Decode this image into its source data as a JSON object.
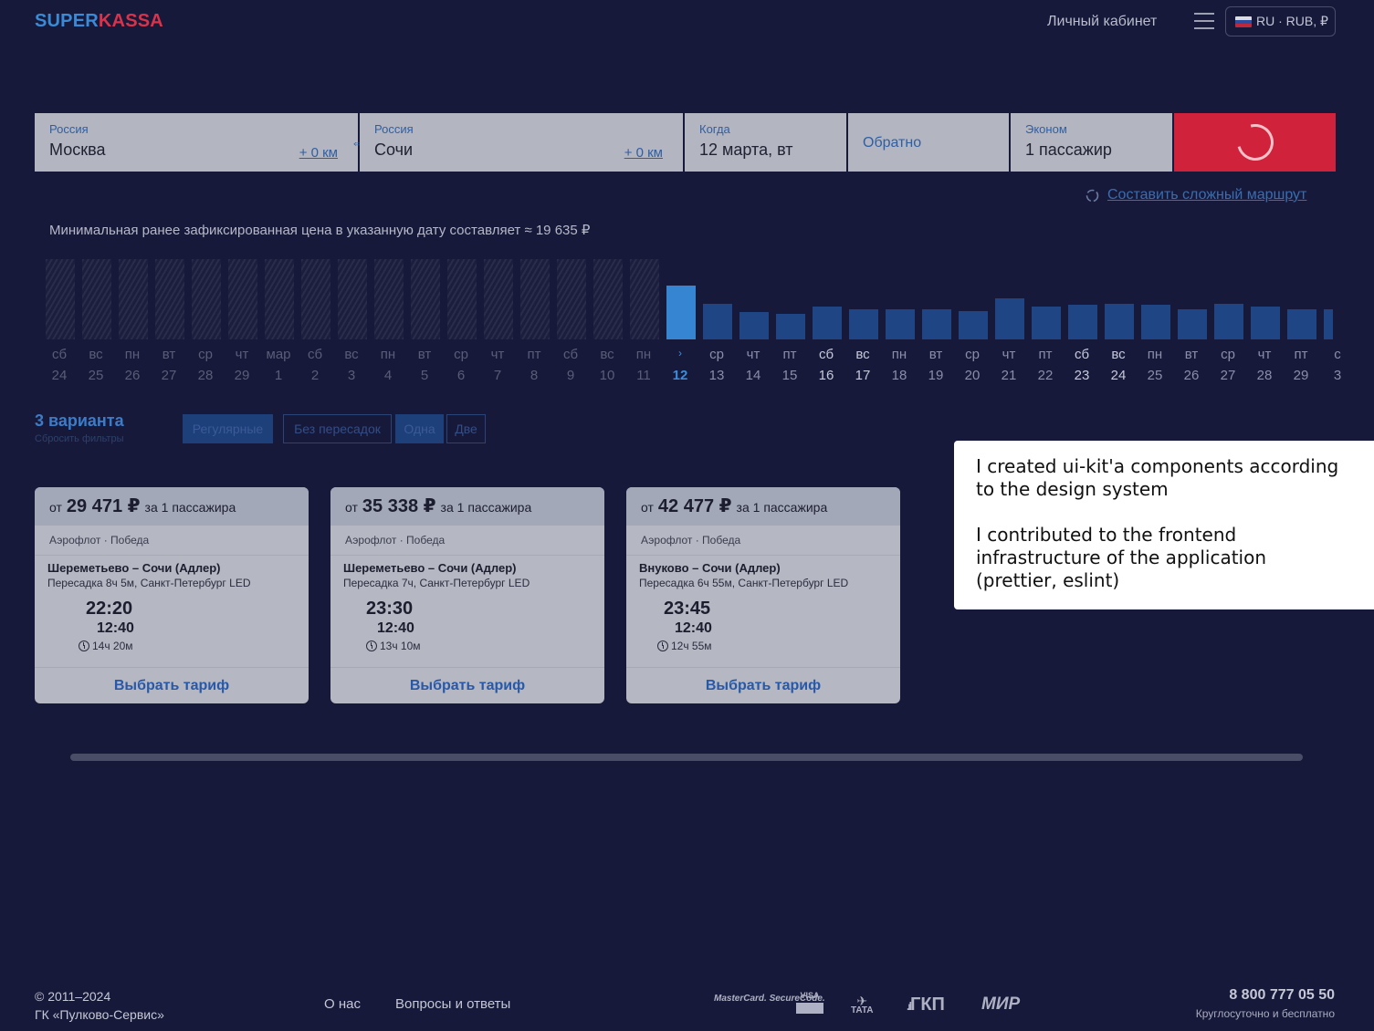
{
  "header": {
    "logo_part1": "SUPER",
    "logo_part2": "KASSA",
    "cabinet": "Личный кабинет",
    "lang": "RU · RUB, ₽"
  },
  "search": {
    "from_country": "Россия",
    "from_city": "Москва",
    "from_km": "+ 0 км",
    "to_country": "Россия",
    "to_city": "Сочи",
    "to_km": "+ 0 км",
    "when_label": "Когда",
    "when_value": "12 марта, вт",
    "return_label": "Обратно",
    "class_label": "Эконом",
    "passengers": "1 пассажир",
    "complex_route": "Составить сложный маршрут"
  },
  "min_price_text": "Минимальная ранее зафиксированная цена в указанную дату составляет ≈ 19 635 ₽",
  "calendar": {
    "selected_weekday_icon": "›",
    "days": [
      {
        "wd": "сб",
        "d": "24",
        "state": "past",
        "level": null
      },
      {
        "wd": "вс",
        "d": "25",
        "state": "past",
        "level": null
      },
      {
        "wd": "пн",
        "d": "26",
        "state": "past",
        "level": null
      },
      {
        "wd": "вт",
        "d": "27",
        "state": "past",
        "level": null
      },
      {
        "wd": "ср",
        "d": "28",
        "state": "past",
        "level": null
      },
      {
        "wd": "чт",
        "d": "29",
        "state": "past",
        "level": null
      },
      {
        "wd": "мар",
        "d": "1",
        "state": "past",
        "level": null
      },
      {
        "wd": "сб",
        "d": "2",
        "state": "past",
        "level": null
      },
      {
        "wd": "вс",
        "d": "3",
        "state": "past",
        "level": null
      },
      {
        "wd": "пн",
        "d": "4",
        "state": "past",
        "level": null
      },
      {
        "wd": "вт",
        "d": "5",
        "state": "past",
        "level": null
      },
      {
        "wd": "ср",
        "d": "6",
        "state": "past",
        "level": null
      },
      {
        "wd": "чт",
        "d": "7",
        "state": "past",
        "level": null
      },
      {
        "wd": "пт",
        "d": "8",
        "state": "past",
        "level": null
      },
      {
        "wd": "сб",
        "d": "9",
        "state": "past",
        "level": null
      },
      {
        "wd": "вс",
        "d": "10",
        "state": "past",
        "level": null
      },
      {
        "wd": "пн",
        "d": "11",
        "state": "past",
        "level": null
      },
      {
        "wd": "",
        "d": "12",
        "state": "selected",
        "level": 0.66
      },
      {
        "wd": "ср",
        "d": "13",
        "state": "future",
        "level": 0.43
      },
      {
        "wd": "чт",
        "d": "14",
        "state": "future",
        "level": 0.33
      },
      {
        "wd": "пт",
        "d": "15",
        "state": "future",
        "level": 0.31
      },
      {
        "wd": "сб",
        "d": "16",
        "state": "future",
        "level": 0.4
      },
      {
        "wd": "вс",
        "d": "17",
        "state": "future",
        "level": 0.37
      },
      {
        "wd": "пн",
        "d": "18",
        "state": "future",
        "level": 0.37
      },
      {
        "wd": "вт",
        "d": "19",
        "state": "future",
        "level": 0.37
      },
      {
        "wd": "ср",
        "d": "20",
        "state": "future",
        "level": 0.34
      },
      {
        "wd": "чт",
        "d": "21",
        "state": "future",
        "level": 0.5
      },
      {
        "wd": "пт",
        "d": "22",
        "state": "future",
        "level": 0.4
      },
      {
        "wd": "сб",
        "d": "23",
        "state": "future",
        "level": 0.42
      },
      {
        "wd": "вс",
        "d": "24",
        "state": "future",
        "level": 0.43
      },
      {
        "wd": "пн",
        "d": "25",
        "state": "future",
        "level": 0.42
      },
      {
        "wd": "вт",
        "d": "26",
        "state": "future",
        "level": 0.37
      },
      {
        "wd": "ср",
        "d": "27",
        "state": "future",
        "level": 0.43
      },
      {
        "wd": "чт",
        "d": "28",
        "state": "future",
        "level": 0.4
      },
      {
        "wd": "пт",
        "d": "29",
        "state": "future",
        "level": 0.37
      },
      {
        "wd": "с",
        "d": "3",
        "state": "future",
        "level": 0.37
      }
    ]
  },
  "filters": {
    "variants": "3 варианта",
    "reset": "Сбросить фильтры",
    "chips": [
      {
        "label": "Регулярные",
        "active": true
      },
      {
        "label": "Без пересадок",
        "active": false
      },
      {
        "label": "Одна",
        "active": true
      },
      {
        "label": "Две",
        "active": false
      }
    ]
  },
  "tooltip": {
    "p1": "I created ui-kit'a components according to the design system",
    "p2": "I contributed to the frontend infrastructure of the application (prettier, eslint)"
  },
  "cards": [
    {
      "from": "от",
      "price": "29 471 ₽",
      "per": "за 1 пассажира",
      "airlines": "Аэрофлот · Победа",
      "route": "Шереметьево – Сочи (Адлер)",
      "transfer": "Пересадка 8ч 5м, Санкт-Петербург LED",
      "dep": "22:20",
      "arr": "12:40",
      "dur": "14ч 20м",
      "cta": "Выбрать тариф"
    },
    {
      "from": "от",
      "price": "35 338 ₽",
      "per": "за 1 пассажира",
      "airlines": "Аэрофлот · Победа",
      "route": "Шереметьево – Сочи (Адлер)",
      "transfer": "Пересадка 7ч, Санкт-Петербург LED",
      "dep": "23:30",
      "arr": "12:40",
      "dur": "13ч 10м",
      "cta": "Выбрать тариф"
    },
    {
      "from": "от",
      "price": "42 477 ₽",
      "per": "за 1 пассажира",
      "airlines": "Аэрофлот · Победа",
      "route": "Внуково – Сочи (Адлер)",
      "transfer": "Пересадка 6ч 55м, Санкт-Петербург LED",
      "dep": "23:45",
      "arr": "12:40",
      "dur": "12ч 55м",
      "cta": "Выбрать тариф"
    }
  ],
  "footer": {
    "copyright": "© 2011–2024",
    "company": "ГК «Пулково-Сервис»",
    "about": "О нас",
    "faq": "Вопросы и ответы",
    "payments": [
      "MasterCard. SecureCode.",
      "VISA",
      "TATA",
      "ГКП",
      "МИР"
    ],
    "phone": "8 800 777 05 50",
    "phone_note": "Круглосуточно и бесплатно"
  }
}
